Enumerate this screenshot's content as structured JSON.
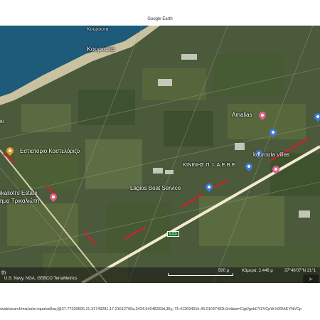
{
  "header": {
    "title": "Google Earth"
  },
  "map": {
    "place_labels": {
      "town_top": "Κουρουτα",
      "town": "Κουρουτα",
      "amalias": "Amalias",
      "restaurant": "Εστιατόριο Καστελόριζο",
      "villas": "kourouta villas",
      "company": "ΚΙΝΙΝΗΣ Π. Ι. Α.Ε.Β.Ε.",
      "boat_service": "Lagios Boat Service",
      "estate_1": "ikalioti's Estate",
      "estate_2": "ημα Τρικαλιώτη",
      "left_fragment": "κι"
    },
    "road_shield": "E55",
    "colors": {
      "sea": "#1e5a7a",
      "road": "#f2ead0",
      "route": "#c0282d",
      "pin_pink": "#e0608a",
      "pin_blue": "#3a7ad8",
      "pin_orange": "#e89a20"
    }
  },
  "bottom_bar": {
    "app_fragment": "th",
    "attribution": "U.S. Navy, NGA, GEBCO   TerraMetrics",
    "scale": "500 μ",
    "altitude": "Κάμερα: 2.446 μ",
    "coordinates": "37°46'07\"N 21°1"
  },
  "footer": {
    "url": "/web/search/παλούκι+αμαλιάδας/@37.77029506,21.31749281,17.21612799a,3434.54048333d,35y,-75.41309401h,45.01047492t,0r/data=CigiJgokCYZVCpW-hDRAEYNVCp"
  }
}
